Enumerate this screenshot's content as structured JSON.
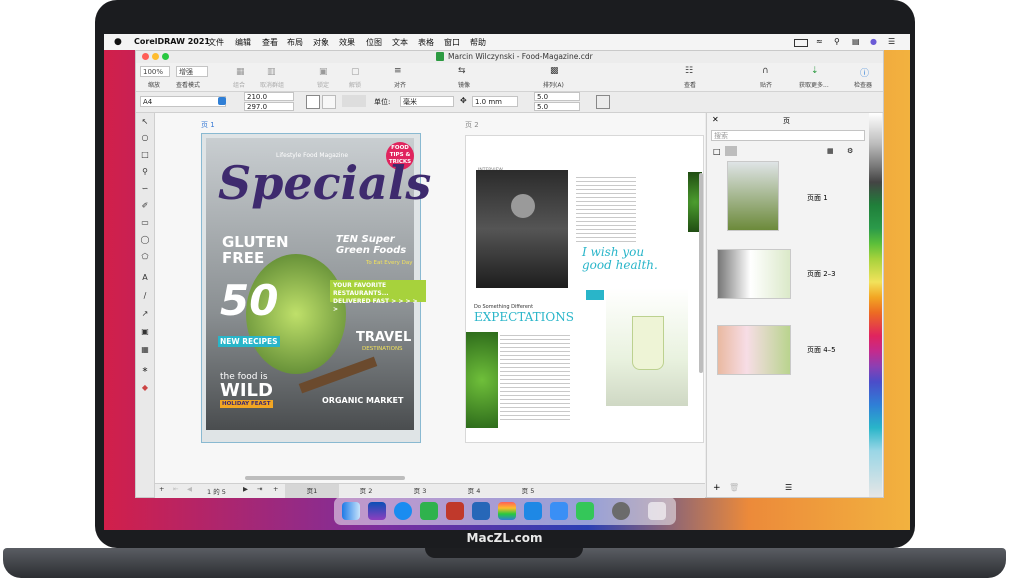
{
  "menubar": {
    "apple": "",
    "app_name": "CorelDRAW 2021",
    "items": [
      "文件",
      "编辑",
      "查看",
      "布局",
      "对象",
      "效果",
      "位图",
      "文本",
      "表格",
      "窗口",
      "帮助"
    ]
  },
  "window": {
    "title": "Marcin Wilczynski - Food-Magazine.cdr"
  },
  "toolbar": {
    "zoom": "100%",
    "zoom_label": "缩放",
    "view_mode": "增强",
    "view_mode_label": "查看模式",
    "items": [
      "组合",
      "取消群组",
      "锁定",
      "解锁",
      "对齐",
      "镜像",
      "排列(A)",
      "查看",
      "贴齐",
      "获取更多...",
      "检查器"
    ]
  },
  "propbar": {
    "page_size": "A4",
    "width": "210.0",
    "height": "297.0",
    "units_label": "单位:",
    "units": "毫米",
    "nudge": "1.0 mm",
    "dup_x": "5.0",
    "dup_y": "5.0"
  },
  "canvas": {
    "page1_label": "页 1",
    "page2_label": "页 2",
    "cover": {
      "title": "Specials",
      "tagline": "Lifestyle Food Magazine",
      "badge": "FOOD TIPS & TRICKS",
      "headline1": "GLUTEN FREE",
      "headline2": "TEN Super Green Foods",
      "headline2_sub": "To Eat Every Day",
      "banner": "YOUR FAVORITE RESTAURANTS... DELIVERED FAST > > > > >",
      "number": "50",
      "new_recipes": "NEW RECIPES",
      "travel": "TRAVEL",
      "travel_sub": "DESTINATIONS",
      "wild_pre": "the food is",
      "wild": "WILD",
      "holiday": "HOLIDAY FEAST",
      "organic": "ORGANIC MARKET"
    },
    "spread": {
      "interview": "INTERVIEW",
      "quote": "I wish you good health.",
      "expectations": "EXPECTATIONS",
      "do_something": "Do Something Different"
    }
  },
  "pagebar": {
    "page_of": "1 的 5",
    "tabs": [
      "页1",
      "页 2",
      "页 3",
      "页 4",
      "页 5"
    ]
  },
  "docker": {
    "title": "页",
    "search_placeholder": "搜索",
    "pages": [
      "页面 1",
      "页面 2–3",
      "页面 4–5"
    ]
  },
  "brand": "MacZL.com",
  "colors": {
    "accent": "#2f7fd6",
    "cover_purple": "#3e2a6e",
    "cover_green": "#8fc23f",
    "teal": "#29b5c9"
  }
}
